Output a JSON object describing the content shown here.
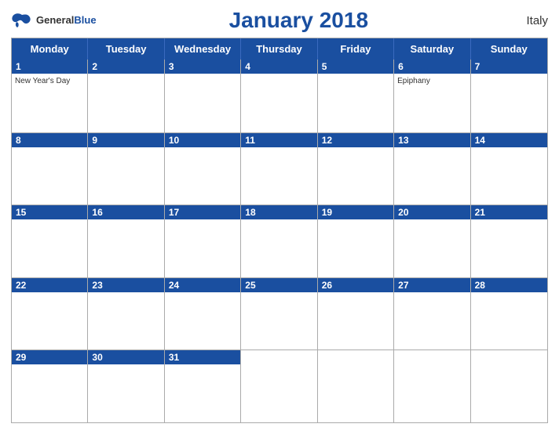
{
  "header": {
    "logo_general": "General",
    "logo_blue": "Blue",
    "title": "January 2018",
    "country": "Italy"
  },
  "days": [
    "Monday",
    "Tuesday",
    "Wednesday",
    "Thursday",
    "Friday",
    "Saturday",
    "Sunday"
  ],
  "weeks": [
    [
      {
        "num": "1",
        "holiday": "New Year's Day"
      },
      {
        "num": "2",
        "holiday": ""
      },
      {
        "num": "3",
        "holiday": ""
      },
      {
        "num": "4",
        "holiday": ""
      },
      {
        "num": "5",
        "holiday": ""
      },
      {
        "num": "6",
        "holiday": "Epiphany"
      },
      {
        "num": "7",
        "holiday": ""
      }
    ],
    [
      {
        "num": "8",
        "holiday": ""
      },
      {
        "num": "9",
        "holiday": ""
      },
      {
        "num": "10",
        "holiday": ""
      },
      {
        "num": "11",
        "holiday": ""
      },
      {
        "num": "12",
        "holiday": ""
      },
      {
        "num": "13",
        "holiday": ""
      },
      {
        "num": "14",
        "holiday": ""
      }
    ],
    [
      {
        "num": "15",
        "holiday": ""
      },
      {
        "num": "16",
        "holiday": ""
      },
      {
        "num": "17",
        "holiday": ""
      },
      {
        "num": "18",
        "holiday": ""
      },
      {
        "num": "19",
        "holiday": ""
      },
      {
        "num": "20",
        "holiday": ""
      },
      {
        "num": "21",
        "holiday": ""
      }
    ],
    [
      {
        "num": "22",
        "holiday": ""
      },
      {
        "num": "23",
        "holiday": ""
      },
      {
        "num": "24",
        "holiday": ""
      },
      {
        "num": "25",
        "holiday": ""
      },
      {
        "num": "26",
        "holiday": ""
      },
      {
        "num": "27",
        "holiday": ""
      },
      {
        "num": "28",
        "holiday": ""
      }
    ],
    [
      {
        "num": "29",
        "holiday": ""
      },
      {
        "num": "30",
        "holiday": ""
      },
      {
        "num": "31",
        "holiday": ""
      },
      {
        "num": "",
        "holiday": ""
      },
      {
        "num": "",
        "holiday": ""
      },
      {
        "num": "",
        "holiday": ""
      },
      {
        "num": "",
        "holiday": ""
      }
    ]
  ]
}
